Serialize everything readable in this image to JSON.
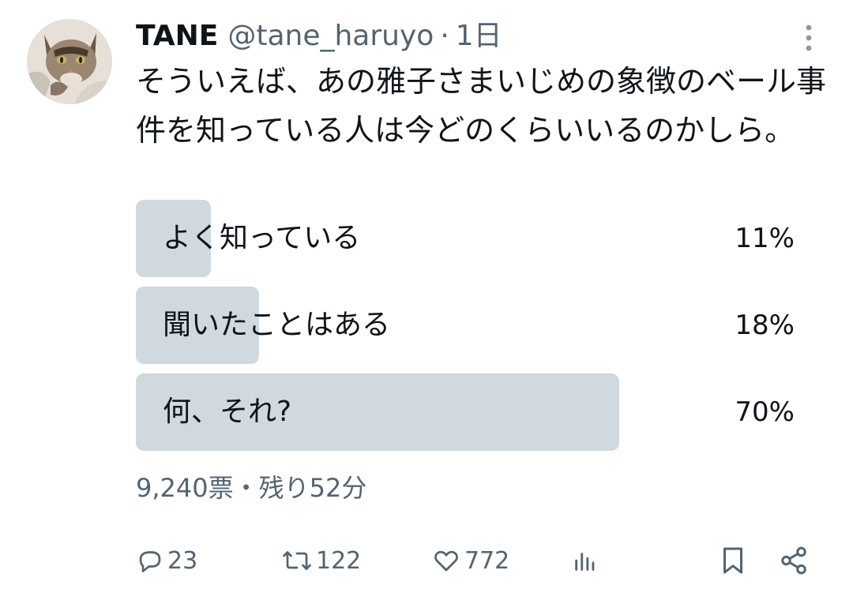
{
  "user": {
    "display_name": "TANE",
    "handle": "@tane_haruyo",
    "separator": "·",
    "time": "1日",
    "avatar_icon": "cat-avatar-icon",
    "more_icon": "more-vertical-icon"
  },
  "tweet": {
    "text": "そういえば、あの雅子さまいじめの象徴のベール事件を知っている人は今どのくらいいるのかしら。"
  },
  "poll": {
    "options": [
      {
        "label": "よく知っている",
        "percent_label": "11%",
        "percent": 11
      },
      {
        "label": "聞いたことはある",
        "percent_label": "18%",
        "percent": 18
      },
      {
        "label": "何、それ?",
        "percent_label": "70%",
        "percent": 70
      }
    ],
    "meta": "9,240票・残り52分",
    "bar_color": "#cfd9de"
  },
  "actions": {
    "reply_count": "23",
    "retweet_count": "122",
    "like_count": "772",
    "icons": [
      "reply-icon",
      "retweet-icon",
      "like-icon",
      "views-icon",
      "bookmark-icon",
      "share-icon"
    ]
  },
  "colors": {
    "text": "#0f1419",
    "secondary": "#536471"
  }
}
